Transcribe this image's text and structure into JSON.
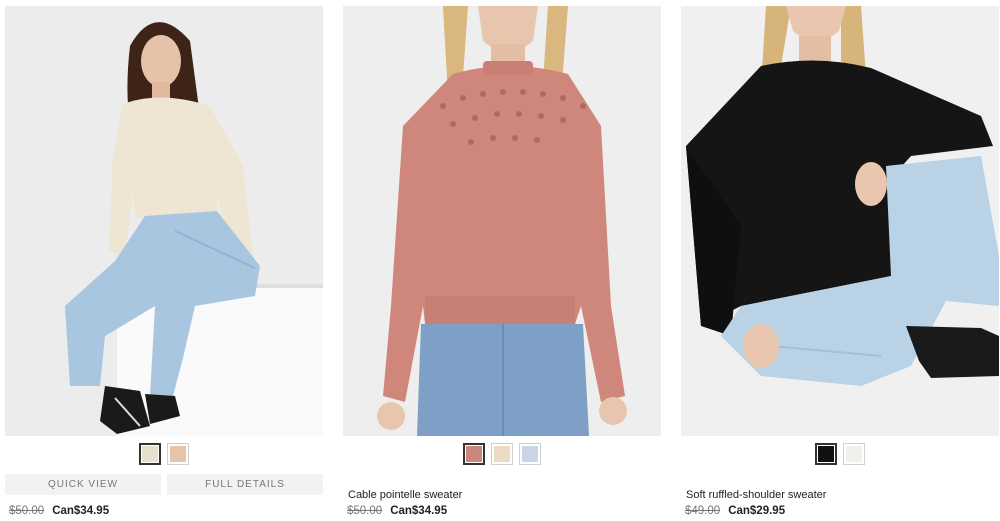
{
  "products": [
    {
      "name": "",
      "old_price": "$50.00",
      "price": "Can$34.95",
      "swatches": [
        {
          "icon": "beige-swatch-icon",
          "color": "#e8dfcf",
          "selected": true
        },
        {
          "icon": "peach-swatch-icon",
          "color": "#e9c2ab",
          "selected": false
        }
      ],
      "quick_view_label": "QUICK VIEW",
      "full_details_label": "FULL DETAILS"
    },
    {
      "name": "Cable pointelle sweater",
      "old_price": "$50.00",
      "price": "Can$34.95",
      "swatches": [
        {
          "icon": "rose-swatch-icon",
          "color": "#cf867a",
          "selected": true
        },
        {
          "icon": "cream-swatch-icon",
          "color": "#eddcc4",
          "selected": false
        },
        {
          "icon": "light-blue-swatch-icon",
          "color": "#c9d6e6",
          "selected": false
        }
      ]
    },
    {
      "name": "Soft ruffled-shoulder sweater",
      "old_price": "$49.00",
      "price": "Can$29.95",
      "swatches": [
        {
          "icon": "black-swatch-icon",
          "color": "#111111",
          "selected": true
        },
        {
          "icon": "ivory-swatch-icon",
          "color": "#f2f0ea",
          "selected": false
        }
      ]
    }
  ]
}
